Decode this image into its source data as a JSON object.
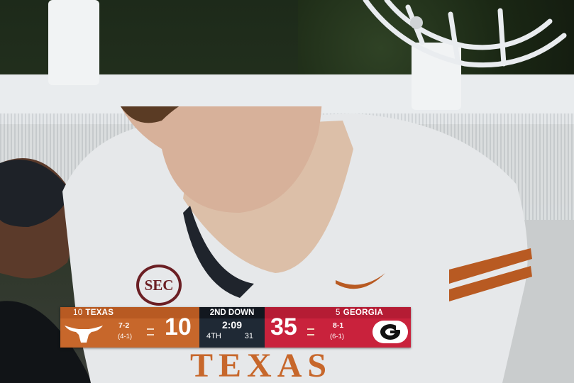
{
  "scorebug": {
    "away": {
      "rank": "10",
      "name": "TEXAS",
      "score": "10",
      "record": "7-2",
      "conf_record": "(4-1)",
      "color": "#c7672b"
    },
    "home": {
      "rank": "5",
      "name": "GEORGIA",
      "score": "35",
      "record": "8-1",
      "conf_record": "(6-1)",
      "color": "#c9223c"
    },
    "down": "2ND DOWN",
    "clock": "2:09",
    "quarter": "4TH",
    "play_clock": "31"
  },
  "jersey": {
    "patch": "SEC",
    "chest_text": "TEXAS"
  },
  "icons": {
    "away_logo": "longhorn-logo-icon",
    "home_logo": "georgia-g-logo-icon",
    "sponsor": "swoosh-icon"
  }
}
